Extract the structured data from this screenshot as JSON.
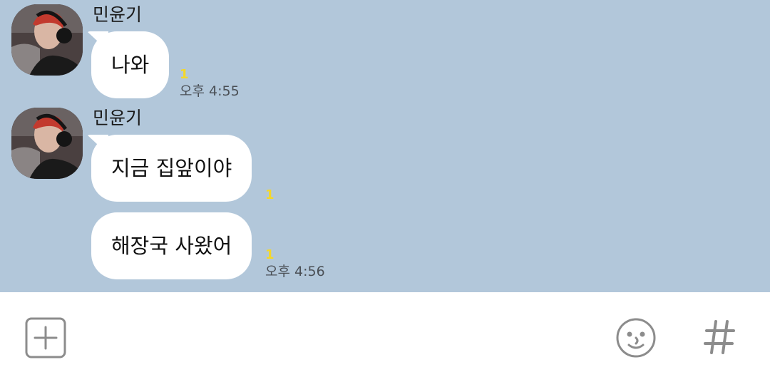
{
  "messages": [
    {
      "sender": "민윤기",
      "bubbles": [
        {
          "text": "나와",
          "unread": "1"
        }
      ],
      "time": "오후 4:55"
    },
    {
      "sender": "민윤기",
      "bubbles": [
        {
          "text": "지금 집앞이야",
          "unread": "1"
        },
        {
          "text": "해장국 사왔어",
          "unread": "1"
        }
      ],
      "time": "오후 4:56"
    }
  ],
  "input_bar": {
    "icons": [
      "plus-icon",
      "emoticon-icon",
      "hashtag-icon"
    ]
  },
  "colors": {
    "chat_background": "#b2c7da",
    "bubble": "#ffffff",
    "unread_count": "#f4d82a",
    "icon": "#8c8c8c"
  }
}
